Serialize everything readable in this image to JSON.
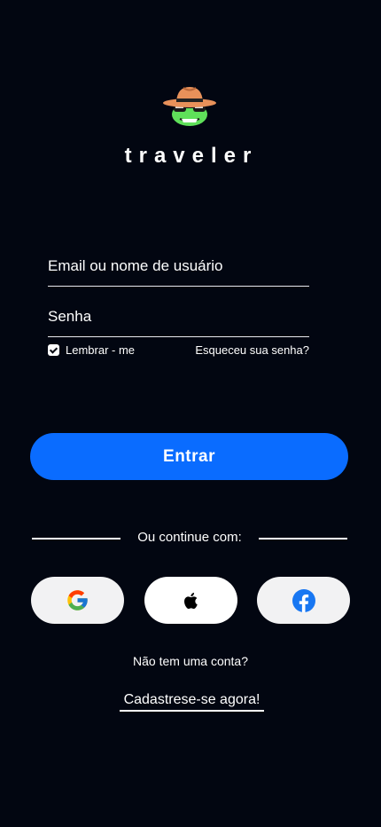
{
  "app": {
    "brand_name": "traveler",
    "logo_icon": "hat-frog-logo"
  },
  "form": {
    "email_placeholder": "Email ou nome de usuário",
    "password_placeholder": "Senha",
    "remember_label": "Lembrar - me",
    "remember_checked": true,
    "forgot_label": "Esqueceu sua senha?",
    "submit_label": "Entrar"
  },
  "social": {
    "divider_label": "Ou continue com:",
    "buttons": [
      {
        "icon": "google-icon"
      },
      {
        "icon": "apple-icon"
      },
      {
        "icon": "facebook-icon"
      }
    ]
  },
  "footer": {
    "no_account_label": "Não tem uma conta?",
    "signup_label": "Cadastrese-se agora!"
  },
  "colors": {
    "background": "#020611",
    "primary": "#0a6cff",
    "logo_hat": "#e8915a",
    "logo_face": "#5fe05a"
  }
}
